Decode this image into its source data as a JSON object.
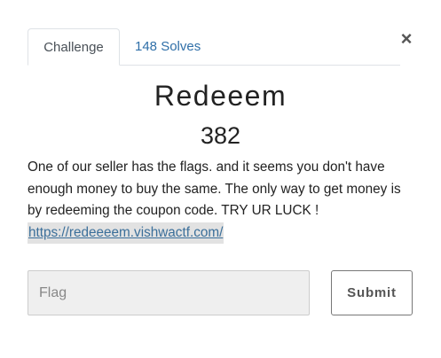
{
  "modal": {
    "close_label": "×",
    "tabs": [
      {
        "label": "Challenge",
        "active": true
      },
      {
        "label": "148 Solves",
        "active": false
      }
    ],
    "challenge": {
      "name": "Redeeem",
      "points": "382",
      "description": "One of our seller has the flags. and it seems you don't have enough money to buy the same. The only way to get money is by redeeming the coupon code. TRY UR LUCK !",
      "link": "https://redeeeem.vishwactf.com/"
    },
    "form": {
      "flag_value": "",
      "flag_placeholder": "Flag",
      "submit_label": "Submit"
    }
  },
  "colors": {
    "link": "#3b6f9a",
    "link_highlight": "#e2e2e2",
    "tab_solves": "#2f6fa8",
    "input_bg": "#efefef"
  },
  "icons": {
    "close": "close-icon"
  }
}
